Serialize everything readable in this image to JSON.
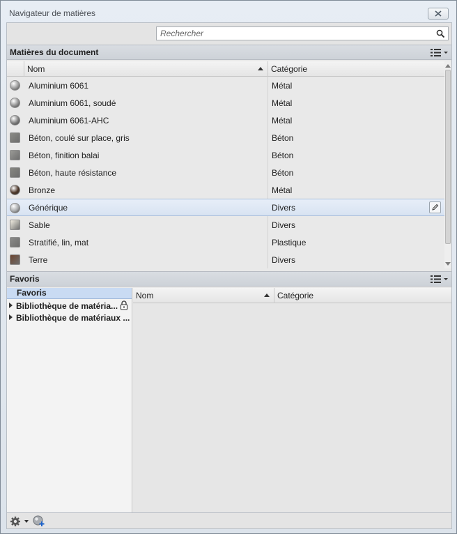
{
  "window": {
    "title": "Navigateur de matières"
  },
  "search": {
    "placeholder": "Rechercher"
  },
  "document_section": {
    "title": "Matières du document",
    "columns": {
      "name": "Nom",
      "category": "Catégorie"
    },
    "rows": [
      {
        "name": "Aluminium 6061",
        "category": "Métal",
        "swatch": "#9a9a9a",
        "shape": "sphere"
      },
      {
        "name": "Aluminium 6061, soudé",
        "category": "Métal",
        "swatch": "#8f8f8f",
        "shape": "sphere"
      },
      {
        "name": "Aluminium 6061-AHC",
        "category": "Métal",
        "swatch": "#7d7d7d",
        "shape": "sphere"
      },
      {
        "name": "Béton, coulé sur place, gris",
        "category": "Béton",
        "swatch": "#8b8b86",
        "shape": "square"
      },
      {
        "name": "Béton, finition balai",
        "category": "Béton",
        "swatch": "#9a9a96",
        "shape": "square"
      },
      {
        "name": "Béton, haute résistance",
        "category": "Béton",
        "swatch": "#878781",
        "shape": "square"
      },
      {
        "name": "Bronze",
        "category": "Métal",
        "swatch": "#4a3426",
        "shape": "sphere"
      },
      {
        "name": "Générique",
        "category": "Divers",
        "swatch": "#a7a9ab",
        "shape": "sphere",
        "selected": true
      },
      {
        "name": "Sable",
        "category": "Divers",
        "swatch": "#f2efe3",
        "shape": "square"
      },
      {
        "name": "Stratifié, lin, mat",
        "category": "Plastique",
        "swatch": "#8a8a88",
        "shape": "square"
      },
      {
        "name": "Terre",
        "category": "Divers",
        "swatch": "#6c4530",
        "shape": "square"
      }
    ]
  },
  "favorites_section": {
    "title": "Favoris",
    "tree_header": "Favoris",
    "tree_items": [
      {
        "label": "Bibliothèque de matéria...",
        "locked": true
      },
      {
        "label": "Bibliothèque de matériaux ...",
        "locked": false
      }
    ],
    "columns": {
      "name": "Nom",
      "category": "Catégorie"
    }
  },
  "icons": {
    "close": "close-icon",
    "search": "search-icon",
    "view_options": "list-view-icon",
    "edit": "pencil-icon",
    "lock": "lock-icon",
    "settings": "gear-icon",
    "add_material": "add-material-icon"
  }
}
